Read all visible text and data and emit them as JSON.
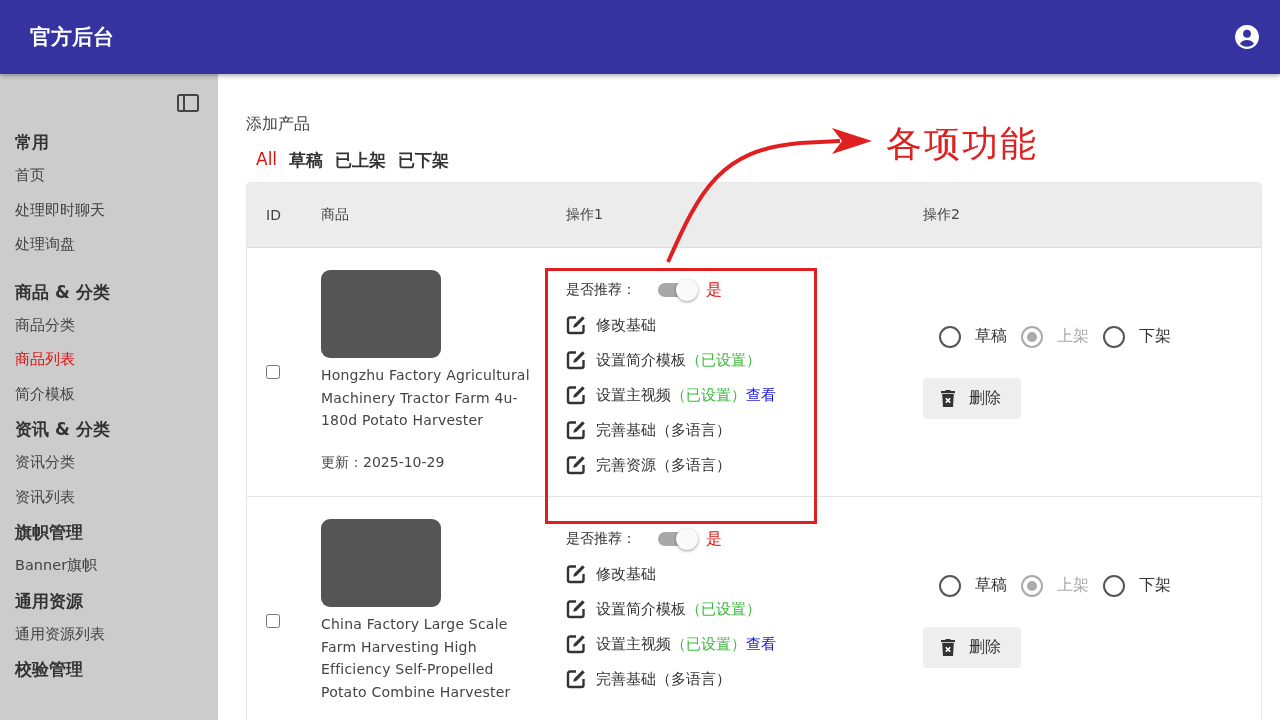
{
  "header": {
    "title": "官方后台"
  },
  "sidebar": {
    "groups": [
      {
        "title": "常用",
        "items": [
          {
            "label": "首页",
            "selected": false
          },
          {
            "label": "处理即时聊天",
            "selected": false
          },
          {
            "label": "处理询盘",
            "selected": false
          }
        ]
      },
      {
        "title": "商品 & 分类",
        "items": [
          {
            "label": "商品分类",
            "selected": false
          },
          {
            "label": "商品列表",
            "selected": true
          },
          {
            "label": "简介模板",
            "selected": false
          }
        ]
      },
      {
        "title": "资讯 & 分类",
        "items": [
          {
            "label": "资讯分类",
            "selected": false
          },
          {
            "label": "资讯列表",
            "selected": false
          }
        ]
      },
      {
        "title": "旗帜管理",
        "items": [
          {
            "label": "Banner旗帜",
            "selected": false
          }
        ]
      },
      {
        "title": "通用资源",
        "items": [
          {
            "label": "通用资源列表",
            "selected": false
          }
        ]
      },
      {
        "title": "校验管理"
      }
    ]
  },
  "add_link": "添加产品",
  "filters": [
    {
      "label": "All",
      "selected": true
    },
    {
      "label": "草稿",
      "selected": false
    },
    {
      "label": "已上架",
      "selected": false
    },
    {
      "label": "已下架",
      "selected": false
    }
  ],
  "table": {
    "columns": [
      "ID",
      "商品",
      "操作1",
      "操作2"
    ],
    "rows": [
      {
        "checked": false,
        "title": "Hongzhu Factory Agricultural Machinery Tractor Farm 4u-180d Potato Harvester",
        "updated": "更新：2025-10-29",
        "recommend": {
          "label": "是否推荐：",
          "on": true,
          "value": "是"
        },
        "actions": [
          {
            "label": "修改基础"
          },
          {
            "label": "设置简介模板",
            "status": "（已设置）"
          },
          {
            "label": "设置主视频",
            "status": "（已设置）",
            "link": "查看"
          },
          {
            "label": "完善基础（多语言）"
          },
          {
            "label": "完善资源（多语言）"
          }
        ],
        "states": [
          {
            "label": "草稿",
            "selected": false
          },
          {
            "label": "上架",
            "selected": true
          },
          {
            "label": "下架",
            "selected": false
          }
        ],
        "delete": "删除"
      },
      {
        "checked": false,
        "title": "China Factory Large Scale Farm Harvesting High Efficiency Self-Propelled Potato Combine Harvester",
        "recommend": {
          "label": "是否推荐：",
          "on": true,
          "value": "是"
        },
        "actions": [
          {
            "label": "修改基础"
          },
          {
            "label": "设置简介模板",
            "status": "（已设置）"
          },
          {
            "label": "设置主视频",
            "status": "（已设置）",
            "link": "查看"
          },
          {
            "label": "完善基础（多语言）"
          }
        ],
        "states": [
          {
            "label": "草稿",
            "selected": false
          },
          {
            "label": "上架",
            "selected": true
          },
          {
            "label": "下架",
            "selected": false
          }
        ],
        "delete": "删除"
      }
    ]
  },
  "annotation": {
    "label": "各项功能"
  }
}
